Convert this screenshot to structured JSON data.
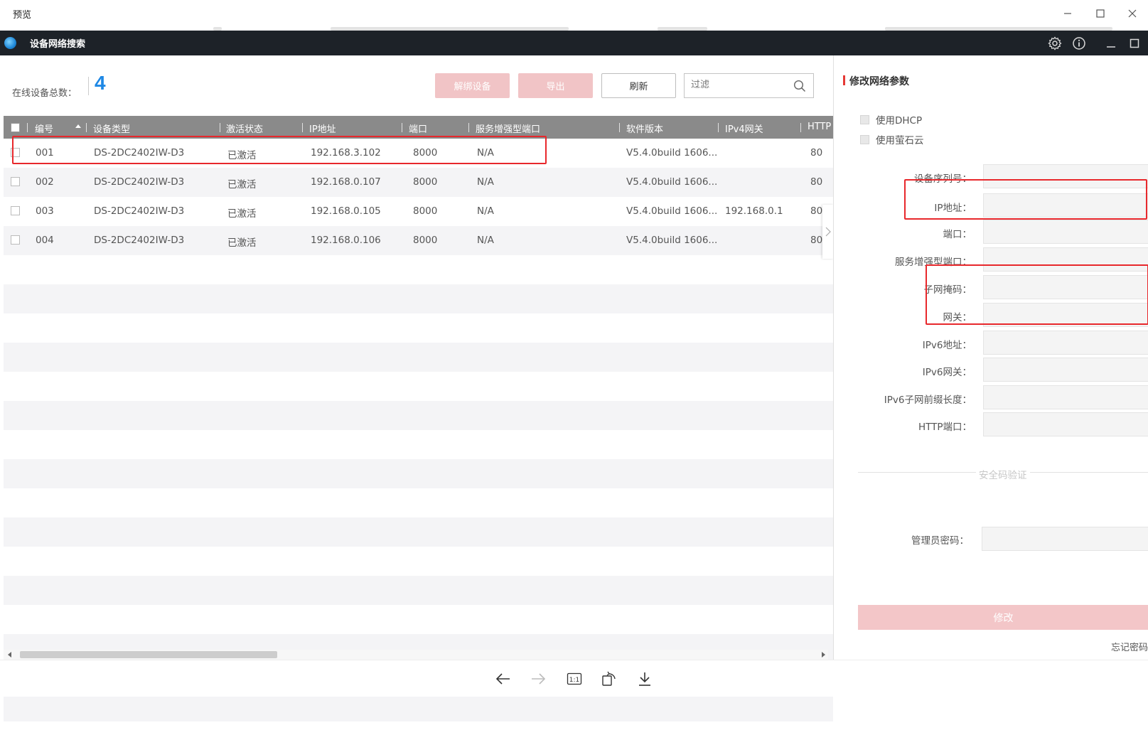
{
  "window": {
    "title": "预览"
  },
  "app": {
    "title": "设备网络搜索"
  },
  "summary": {
    "label": "在线设备总数：",
    "count": "4"
  },
  "toolbar": {
    "unbind_label": "解绑设备",
    "export_label": "导出",
    "refresh_label": "刷新",
    "filter_placeholder": "过滤"
  },
  "table": {
    "headers": {
      "no": "编号",
      "type": "设备类型",
      "status": "激活状态",
      "ip": "IP地址",
      "port": "端口",
      "enhanced_port": "服务增强型端口",
      "software": "软件版本",
      "ipv4_gateway": "IPv4网关",
      "http": "HTTP"
    },
    "rows": [
      {
        "no": "001",
        "type": "DS-2DC2402IW-D3",
        "status": "已激活",
        "ip": "192.168.3.102",
        "port": "8000",
        "enhanced_port": "N/A",
        "software": "V5.4.0build 1606...",
        "ipv4_gateway": "",
        "http": "80"
      },
      {
        "no": "002",
        "type": "DS-2DC2402IW-D3",
        "status": "已激活",
        "ip": "192.168.0.107",
        "port": "8000",
        "enhanced_port": "N/A",
        "software": "V5.4.0build 1606...",
        "ipv4_gateway": "",
        "http": "80"
      },
      {
        "no": "003",
        "type": "DS-2DC2402IW-D3",
        "status": "已激活",
        "ip": "192.168.0.105",
        "port": "8000",
        "enhanced_port": "N/A",
        "software": "V5.4.0build 1606...",
        "ipv4_gateway": "192.168.0.1",
        "http": "80"
      },
      {
        "no": "004",
        "type": "DS-2DC2402IW-D3",
        "status": "已激活",
        "ip": "192.168.0.106",
        "port": "8000",
        "enhanced_port": "N/A",
        "software": "V5.4.0build 1606...",
        "ipv4_gateway": "",
        "http": "80"
      }
    ]
  },
  "panel": {
    "title": "修改网络参数",
    "use_dhcp": "使用DHCP",
    "use_ezviz": "使用萤石云",
    "fields": {
      "serial": "设备序列号：",
      "ip": "IP地址：",
      "port": "端口：",
      "enhanced_port": "服务增强型端口：",
      "subnet": "子网掩码：",
      "gateway": "网关：",
      "ipv6_addr": "IPv6地址：",
      "ipv6_gateway": "IPv6网关：",
      "ipv6_prefix": "IPv6子网前缀长度：",
      "http_port": "HTTP端口："
    },
    "security_label": "安全码验证",
    "admin_password": "管理员密码：",
    "modify_label": "修改",
    "forgot_label": "忘记密码"
  },
  "colors": {
    "header_bg": "#1d2228",
    "accent_blue": "#1e88e5",
    "disabled_red": "#f1c4c6",
    "highlight_red": "#e8282c"
  }
}
